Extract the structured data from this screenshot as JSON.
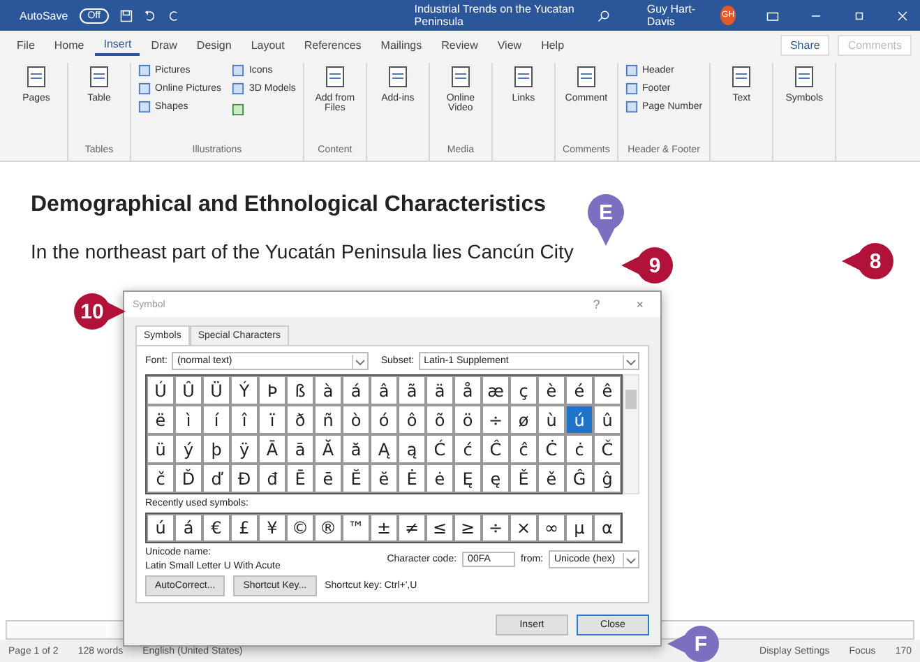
{
  "title_bar": {
    "autosave_label": "AutoSave",
    "autosave_toggle": "Off",
    "document_title": "Industrial Trends on the Yucatan Peninsula",
    "user_name": "Guy Hart-Davis",
    "user_initials": "GH"
  },
  "ribbon_tabs": [
    {
      "label": "File",
      "selected": false
    },
    {
      "label": "Home",
      "selected": false
    },
    {
      "label": "Insert",
      "selected": true
    },
    {
      "label": "Draw",
      "selected": false
    },
    {
      "label": "Design",
      "selected": false
    },
    {
      "label": "Layout",
      "selected": false
    },
    {
      "label": "References",
      "selected": false
    },
    {
      "label": "Mailings",
      "selected": false
    },
    {
      "label": "Review",
      "selected": false
    },
    {
      "label": "View",
      "selected": false
    },
    {
      "label": "Help",
      "selected": false
    }
  ],
  "share_button": "Share",
  "comments_button": "Comments",
  "ribbon_groups": [
    {
      "kind": "big",
      "items": [
        {
          "label": "Pages"
        }
      ]
    },
    {
      "label": "Tables",
      "kind": "big",
      "items": [
        {
          "label": "Table"
        }
      ]
    },
    {
      "label": "Illustrations",
      "kind": "list",
      "items": [
        {
          "label": "Pictures"
        },
        {
          "label": "Online Pictures"
        },
        {
          "label": "Shapes"
        }
      ],
      "items2": [
        {
          "label": "Icons"
        },
        {
          "label": "3D Models"
        }
      ]
    },
    {
      "label": "Content",
      "kind": "big",
      "items": [
        {
          "label": "Add from Files"
        }
      ]
    },
    {
      "kind": "big",
      "items": [
        {
          "label": "Add-ins"
        }
      ]
    },
    {
      "label": "Media",
      "kind": "big",
      "items": [
        {
          "label": "Online Video"
        }
      ]
    },
    {
      "kind": "big",
      "items": [
        {
          "label": "Links"
        }
      ]
    },
    {
      "label": "Comments",
      "kind": "big",
      "items": [
        {
          "label": "Comment"
        }
      ]
    },
    {
      "label": "Header & Footer",
      "kind": "list",
      "items": [
        {
          "label": "Header"
        },
        {
          "label": "Footer"
        },
        {
          "label": "Page Number"
        }
      ]
    },
    {
      "kind": "big",
      "items": [
        {
          "label": "Text"
        }
      ]
    },
    {
      "kind": "big",
      "items": [
        {
          "label": "Symbols"
        }
      ]
    }
  ],
  "document": {
    "heading": "Demographical and Ethnological Characteristics",
    "paragraph": "In the northeast part of the Yucatán Peninsula lies Cancún City"
  },
  "symbol_dialog": {
    "title": "Symbol",
    "help": "?",
    "close_icon": "×",
    "tabs": [
      {
        "label": "Symbols",
        "selected": true
      },
      {
        "label": "Special Characters",
        "selected": false
      }
    ],
    "font_label": "Font:",
    "font_value": "(normal text)",
    "subset_label": "Subset:",
    "subset_value": "Latin-1 Supplement",
    "grid": [
      [
        {
          "c": "Ú",
          "selected": false
        },
        {
          "c": "Û",
          "selected": false
        },
        {
          "c": "Ü",
          "selected": false
        },
        {
          "c": "Ý",
          "selected": false
        },
        {
          "c": "Þ",
          "selected": false
        },
        {
          "c": "ß",
          "selected": false
        },
        {
          "c": "à",
          "selected": false
        },
        {
          "c": "á",
          "selected": false
        },
        {
          "c": "â",
          "selected": false
        },
        {
          "c": "ã",
          "selected": false
        },
        {
          "c": "ä",
          "selected": false
        },
        {
          "c": "å",
          "selected": false
        },
        {
          "c": "æ",
          "selected": false
        },
        {
          "c": "ç",
          "selected": false
        },
        {
          "c": "è",
          "selected": false
        },
        {
          "c": "é",
          "selected": false
        },
        {
          "c": "ê",
          "selected": false
        }
      ],
      [
        {
          "c": "ë",
          "selected": false
        },
        {
          "c": "ì",
          "selected": false
        },
        {
          "c": "í",
          "selected": false
        },
        {
          "c": "î",
          "selected": false
        },
        {
          "c": "ï",
          "selected": false
        },
        {
          "c": "ð",
          "selected": false
        },
        {
          "c": "ñ",
          "selected": false
        },
        {
          "c": "ò",
          "selected": false
        },
        {
          "c": "ó",
          "selected": false
        },
        {
          "c": "ô",
          "selected": false
        },
        {
          "c": "õ",
          "selected": false
        },
        {
          "c": "ö",
          "selected": false
        },
        {
          "c": "÷",
          "selected": false
        },
        {
          "c": "ø",
          "selected": false
        },
        {
          "c": "ù",
          "selected": false
        },
        {
          "c": "ú",
          "selected": true
        },
        {
          "c": "û",
          "selected": false
        }
      ],
      [
        {
          "c": "ü",
          "selected": false
        },
        {
          "c": "ý",
          "selected": false
        },
        {
          "c": "þ",
          "selected": false
        },
        {
          "c": "ÿ",
          "selected": false
        },
        {
          "c": "Ā",
          "selected": false
        },
        {
          "c": "ā",
          "selected": false
        },
        {
          "c": "Ă",
          "selected": false
        },
        {
          "c": "ă",
          "selected": false
        },
        {
          "c": "Ą",
          "selected": false
        },
        {
          "c": "ą",
          "selected": false
        },
        {
          "c": "Ć",
          "selected": false
        },
        {
          "c": "ć",
          "selected": false
        },
        {
          "c": "Ĉ",
          "selected": false
        },
        {
          "c": "ĉ",
          "selected": false
        },
        {
          "c": "Ċ",
          "selected": false
        },
        {
          "c": "ċ",
          "selected": false
        },
        {
          "c": "Č",
          "selected": false
        }
      ],
      [
        {
          "c": "č",
          "selected": false
        },
        {
          "c": "Ď",
          "selected": false
        },
        {
          "c": "ď",
          "selected": false
        },
        {
          "c": "Đ",
          "selected": false
        },
        {
          "c": "đ",
          "selected": false
        },
        {
          "c": "Ē",
          "selected": false
        },
        {
          "c": "ē",
          "selected": false
        },
        {
          "c": "Ĕ",
          "selected": false
        },
        {
          "c": "ĕ",
          "selected": false
        },
        {
          "c": "Ė",
          "selected": false
        },
        {
          "c": "ė",
          "selected": false
        },
        {
          "c": "Ę",
          "selected": false
        },
        {
          "c": "ę",
          "selected": false
        },
        {
          "c": "Ě",
          "selected": false
        },
        {
          "c": "ě",
          "selected": false
        },
        {
          "c": "Ĝ",
          "selected": false
        },
        {
          "c": "ĝ",
          "selected": false
        }
      ]
    ],
    "recent_label": "Recently used symbols:",
    "recent": [
      "ú",
      "á",
      "€",
      "£",
      "¥",
      "©",
      "®",
      "™",
      "±",
      "≠",
      "≤",
      "≥",
      "÷",
      "×",
      "∞",
      "µ",
      "α"
    ],
    "unicode_name_label": "Unicode name:",
    "unicode_name": "Latin Small Letter U With Acute",
    "code_label": "Character code:",
    "code_value": "00FA",
    "from_label": "from:",
    "from_value": "Unicode (hex)",
    "autocorrect_button": "AutoCorrect...",
    "shortcut_button": "Shortcut Key...",
    "shortcut_text": "Shortcut key: Ctrl+',U",
    "insert_button": "Insert",
    "close_button": "Close"
  },
  "status_bar": {
    "page": "Page 1 of 2",
    "words": "128 words",
    "language": "English (United States)",
    "display": "Display Settings",
    "focus": "Focus",
    "zoom": "170"
  },
  "callouts": [
    {
      "label": "E",
      "color": "#7b6fc0"
    },
    {
      "label": "9",
      "color": "#b0123a"
    },
    {
      "label": "8",
      "color": "#b0123a"
    },
    {
      "label": "10",
      "color": "#b0123a"
    },
    {
      "label": "F",
      "color": "#7b6fc0"
    }
  ]
}
